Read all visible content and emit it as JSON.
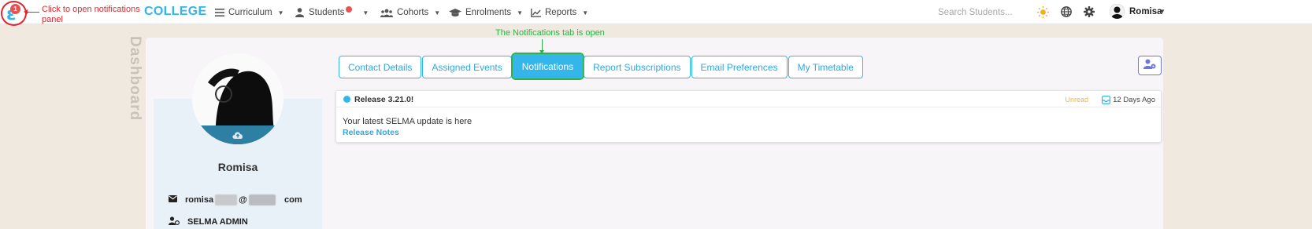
{
  "annotations": {
    "notifications_hint": "Click to open notifications panel",
    "tab_hint": "The Notifications tab is open"
  },
  "logo": {
    "badge_count": "1",
    "icon": "selma-logo-icon"
  },
  "navbar": {
    "brand": "COLLEGE",
    "items": [
      {
        "label": "Curriculum",
        "icon": "list-icon"
      },
      {
        "label": "Students",
        "icon": "person-icon"
      },
      {
        "label": "Cohorts",
        "icon": "users-icon"
      },
      {
        "label": "Enrolments",
        "icon": "graduation-cap-icon"
      },
      {
        "label": "Reports",
        "icon": "chart-line-icon"
      }
    ],
    "search_placeholder": "Search Students...",
    "user_name": "Romisa"
  },
  "sidebar": {
    "vertical_label": "Dashboard"
  },
  "profile": {
    "name": "Romisa",
    "email_start": "romisa",
    "email_at": "@",
    "email_end": "com",
    "role": "SELMA ADMIN"
  },
  "tabs": [
    {
      "label": "Contact Details",
      "active": false
    },
    {
      "label": "Assigned Events",
      "active": false
    },
    {
      "label": "Notifications",
      "active": true
    },
    {
      "label": "Report Subscriptions",
      "active": false
    },
    {
      "label": "Email Preferences",
      "active": false
    },
    {
      "label": "My Timetable",
      "active": false
    }
  ],
  "notification": {
    "title": "Release 3.21.0!",
    "status": "Unread",
    "time": "12 Days Ago",
    "body": "Your latest SELMA update is here",
    "link": "Release Notes"
  },
  "colors": {
    "accent": "#35b6ea",
    "annotation_red": "#e2262d",
    "annotation_green": "#2db24a",
    "unread": "#f3b634",
    "background": "#efe9e0"
  }
}
